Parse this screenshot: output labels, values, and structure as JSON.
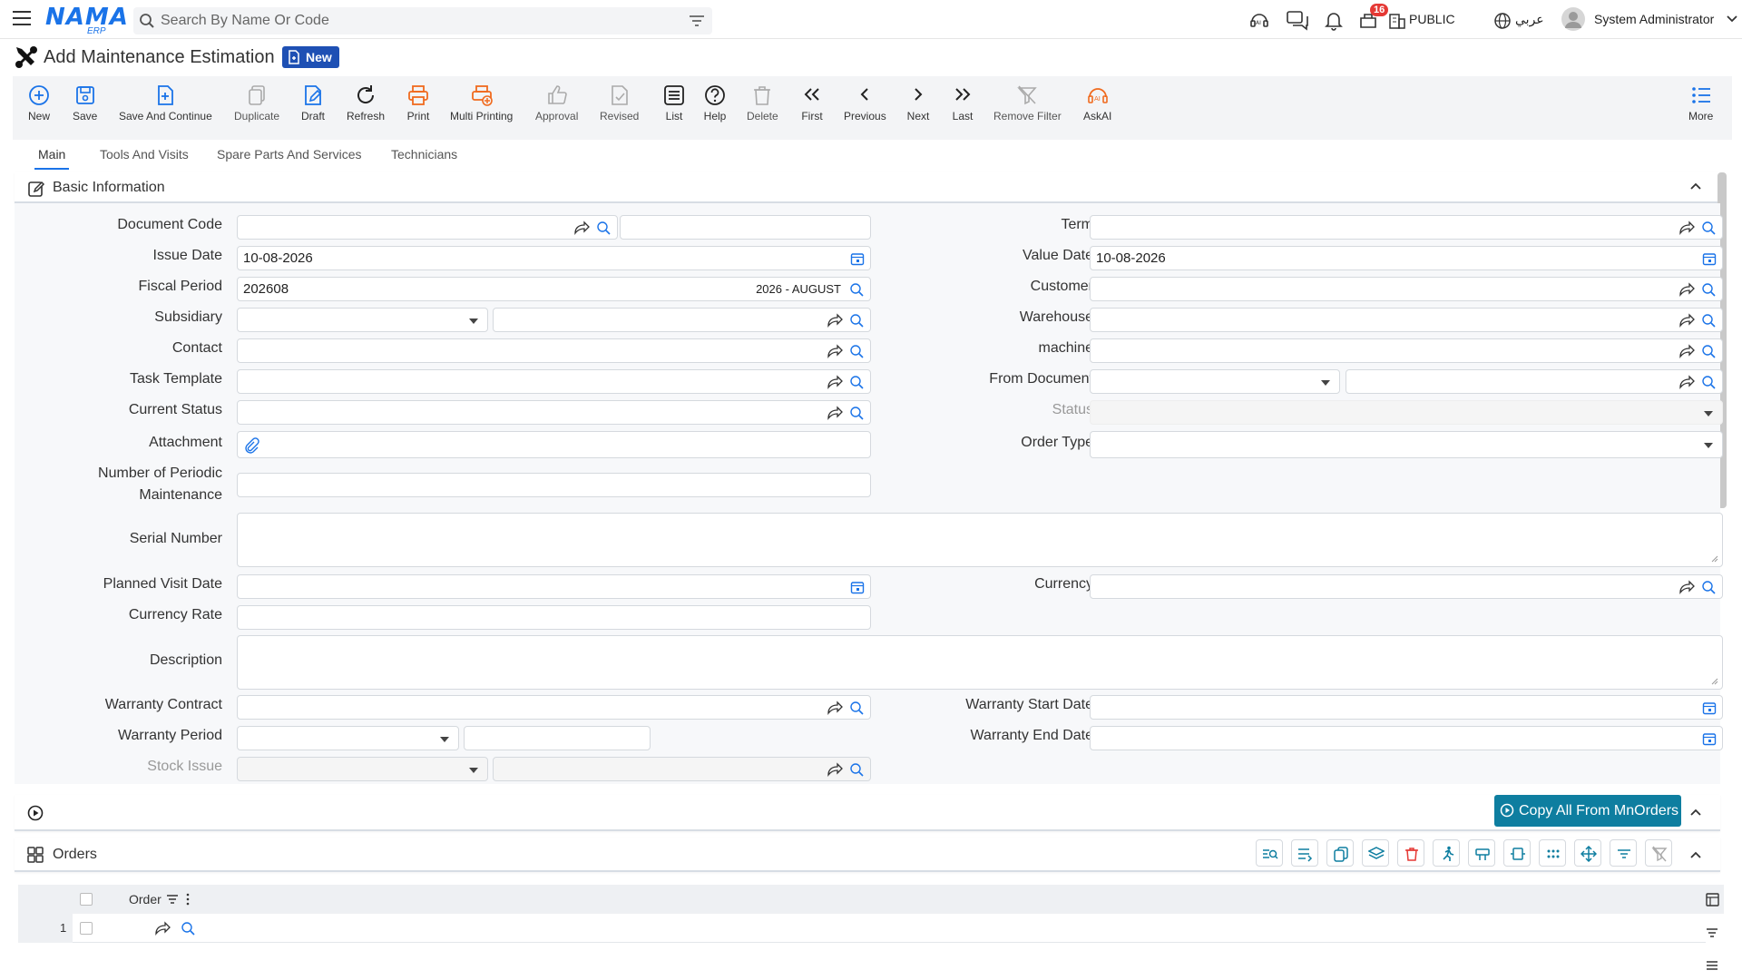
{
  "app": {
    "logo_main": "NAMA",
    "logo_sub": "ERP",
    "search_placeholder": "Search By Name Or Code",
    "notifications_count": "16",
    "workspace": "PUBLIC",
    "language": "عربي",
    "user": "System Administrator"
  },
  "page": {
    "title": "Add Maintenance Estimation",
    "status_badge": "New"
  },
  "toolbar": [
    {
      "key": "new",
      "label": "New",
      "icon": "plus-circle-icon"
    },
    {
      "key": "save",
      "label": "Save",
      "icon": "save-icon"
    },
    {
      "key": "save_continue",
      "label": "Save And Continue",
      "icon": "save-continue-icon"
    },
    {
      "key": "duplicate",
      "label": "Duplicate",
      "icon": "duplicate-icon"
    },
    {
      "key": "draft",
      "label": "Draft",
      "icon": "draft-icon"
    },
    {
      "key": "refresh",
      "label": "Refresh",
      "icon": "refresh-icon"
    },
    {
      "key": "print",
      "label": "Print",
      "icon": "print-icon"
    },
    {
      "key": "multi_printing",
      "label": "Multi Printing",
      "icon": "multi-print-icon"
    },
    {
      "key": "approval",
      "label": "Approval",
      "icon": "approval-icon"
    },
    {
      "key": "revised",
      "label": "Revised",
      "icon": "revised-icon"
    },
    {
      "key": "list",
      "label": "List",
      "icon": "list-icon"
    },
    {
      "key": "help",
      "label": "Help",
      "icon": "help-icon"
    },
    {
      "key": "delete",
      "label": "Delete",
      "icon": "trash-icon"
    },
    {
      "key": "first",
      "label": "First",
      "icon": "double-chevron-left-icon"
    },
    {
      "key": "previous",
      "label": "Previous",
      "icon": "chevron-left-icon"
    },
    {
      "key": "next",
      "label": "Next",
      "icon": "chevron-right-icon"
    },
    {
      "key": "last",
      "label": "Last",
      "icon": "double-chevron-right-icon"
    },
    {
      "key": "remove_filter",
      "label": "Remove Filter",
      "icon": "remove-filter-icon"
    },
    {
      "key": "askai",
      "label": "AskAI",
      "icon": "ai-icon"
    },
    {
      "key": "more",
      "label": "More",
      "icon": "more-list-icon"
    }
  ],
  "tabs": [
    "Main",
    "Tools And Visits",
    "Spare Parts And Services",
    "Technicians"
  ],
  "basic_info": {
    "title": "Basic Information",
    "labels": {
      "document_code": "Document Code",
      "issue_date": "Issue Date",
      "fiscal_period": "Fiscal Period",
      "subsidiary": "Subsidiary",
      "contact": "Contact",
      "task_template": "Task Template",
      "current_status": "Current Status",
      "attachment": "Attachment",
      "num_periodic_1": "Number of Periodic",
      "num_periodic_2": "Maintenance",
      "serial_number": "Serial Number",
      "planned_visit_date": "Planned Visit Date",
      "currency_rate": "Currency Rate",
      "description": "Description",
      "warranty_contract": "Warranty Contract",
      "warranty_period": "Warranty Period",
      "stock_issue": "Stock Issue",
      "term": "Term",
      "value_date": "Value Date",
      "customer": "Customer",
      "warehouse": "Warehouse",
      "machine": "machine",
      "from_document": "From Document",
      "status": "Status",
      "order_type": "Order Type",
      "currency": "Currency",
      "warranty_start_date": "Warranty Start Date",
      "warranty_end_date": "Warranty End Date"
    },
    "values": {
      "issue_date": "10-08-2026",
      "value_date": "10-08-2026",
      "fiscal_period": "202608",
      "fiscal_period_name": "2026 - AUGUST"
    }
  },
  "orders": {
    "copy_button": "Copy All From MnOrders",
    "title": "Orders",
    "column_order": "Order",
    "rows": [
      {
        "num": "1"
      }
    ]
  },
  "colors": {
    "accent": "#1a73e8",
    "badge_bg": "#1e50b4",
    "copy_btn": "#0e7ea0",
    "orange": "#f06a1e",
    "notification": "#e53935"
  }
}
